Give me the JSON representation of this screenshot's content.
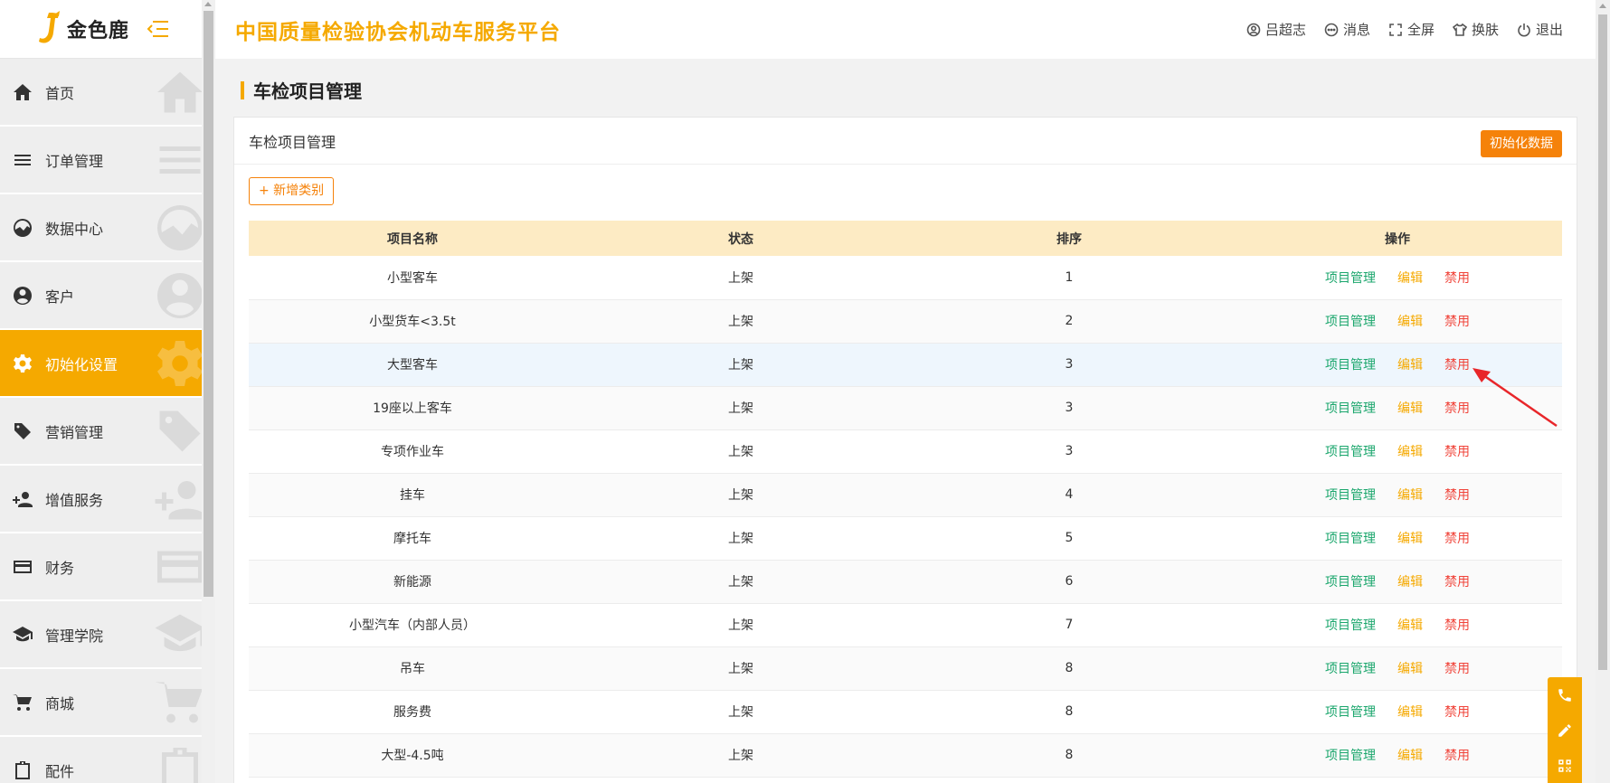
{
  "brand": {
    "name": "金色鹿"
  },
  "header": {
    "title": "中国质量检验协会机动车服务平台",
    "user": "吕超志",
    "messages": "消息",
    "fullscreen": "全屏",
    "skin": "换肤",
    "logout": "退出"
  },
  "sidebar": {
    "items": [
      {
        "label": "首页",
        "icon": "home-icon"
      },
      {
        "label": "订单管理",
        "icon": "list-icon"
      },
      {
        "label": "数据中心",
        "icon": "chart-icon"
      },
      {
        "label": "客户",
        "icon": "user-icon"
      },
      {
        "label": "初始化设置",
        "icon": "gear-icon",
        "active": true
      },
      {
        "label": "营销管理",
        "icon": "tag-icon"
      },
      {
        "label": "增值服务",
        "icon": "add-user-icon"
      },
      {
        "label": "财务",
        "icon": "card-icon"
      },
      {
        "label": "管理学院",
        "icon": "graduation-icon"
      },
      {
        "label": "商城",
        "icon": "cart-icon"
      },
      {
        "label": "配件",
        "icon": "clipboard-icon"
      }
    ]
  },
  "page": {
    "heading": "车检项目管理",
    "card_title": "车检项目管理",
    "init_button": "初始化数据",
    "add_button": "+ 新增类别"
  },
  "table": {
    "headers": [
      "项目名称",
      "状态",
      "排序",
      "操作"
    ],
    "actions": {
      "manage": "项目管理",
      "edit": "编辑",
      "disable": "禁用"
    },
    "rows": [
      {
        "name": "小型客车",
        "status": "上架",
        "sort": "1"
      },
      {
        "name": "小型货车<3.5t",
        "status": "上架",
        "sort": "2"
      },
      {
        "name": "大型客车",
        "status": "上架",
        "sort": "3"
      },
      {
        "name": "19座以上客车",
        "status": "上架",
        "sort": "3"
      },
      {
        "name": "专项作业车",
        "status": "上架",
        "sort": "3"
      },
      {
        "name": "挂车",
        "status": "上架",
        "sort": "4"
      },
      {
        "name": "摩托车",
        "status": "上架",
        "sort": "5"
      },
      {
        "name": "新能源",
        "status": "上架",
        "sort": "6"
      },
      {
        "name": "小型汽车（内部人员）",
        "status": "上架",
        "sort": "7"
      },
      {
        "name": "吊车",
        "status": "上架",
        "sort": "8"
      },
      {
        "name": "服务费",
        "status": "上架",
        "sort": "8"
      },
      {
        "name": "大型-4.5吨",
        "status": "上架",
        "sort": "8"
      }
    ]
  },
  "colors": {
    "accent": "#f5a900",
    "button_orange": "#f5820a",
    "manage_green": "#1aa66c",
    "disable_red": "#f0443a",
    "table_header_bg": "#fdebc4"
  }
}
